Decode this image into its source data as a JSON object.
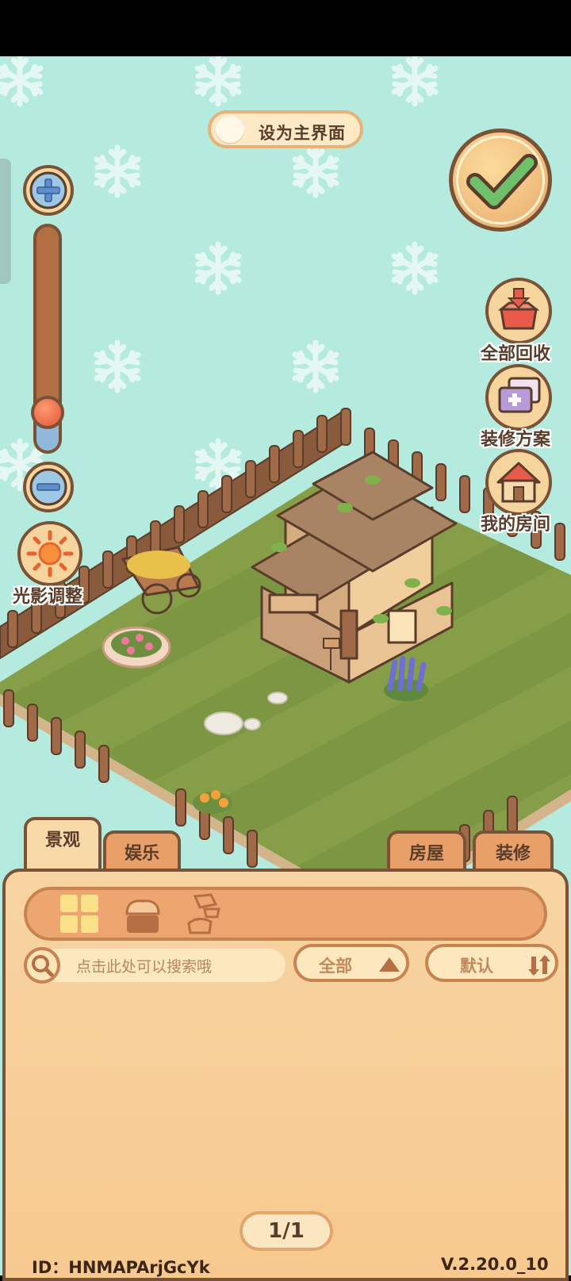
{
  "toggle": {
    "label": "设为主界面"
  },
  "left_controls": {
    "lighting_label": "光影调整",
    "zoom_level": 0.18
  },
  "right_controls": {
    "recycle_all": "全部回收",
    "decor_plan": "装修方案",
    "my_room": "我的房间"
  },
  "tabs": {
    "left": [
      "景观",
      "娱乐"
    ],
    "right": [
      "房屋",
      "装修"
    ],
    "active": "景观"
  },
  "filters": {
    "search_placeholder": "点击此处可以搜索哦",
    "category": "全部",
    "sort": "默认"
  },
  "pager": "1/1",
  "footer": {
    "id": "ID：HNMAPArjGcYk",
    "version": "V.2.20.0_10"
  },
  "colors": {
    "background": "#b5eadf",
    "panel": "#f7d4a2",
    "accent": "#e89f68",
    "outline": "#7a5236"
  }
}
